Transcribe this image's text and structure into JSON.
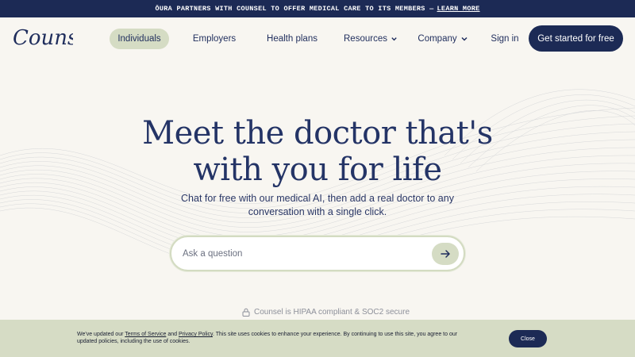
{
  "announcement": {
    "text": "ŌURA PARTNERS WITH COUNSEL TO OFFER MEDICAL CARE TO ITS MEMBERS —",
    "link": "LEARN MORE"
  },
  "nav": {
    "logo_text": "Counsel",
    "items": [
      {
        "label": "Individuals",
        "active": true
      },
      {
        "label": "Employers"
      },
      {
        "label": "Health plans"
      },
      {
        "label": "Resources",
        "has_dropdown": true
      },
      {
        "label": "Company",
        "has_dropdown": true
      },
      {
        "label": "Sign in"
      }
    ],
    "cta": "Get started for free"
  },
  "hero": {
    "title_line1": "Meet the doctor that's",
    "title_line2": "with you for life",
    "subtitle": "Chat for free with our medical AI, then add a real doctor to any conversation with a single click."
  },
  "search": {
    "placeholder": "Ask a question",
    "submit_icon": "arrow-right-icon"
  },
  "security": {
    "icon": "lock-icon",
    "text": "Counsel is HIPAA compliant & SOC2 secure"
  },
  "cookie": {
    "prefix": "We've updated our",
    "terms": "Terms of Service",
    "and": "and",
    "privacy": "Privacy Policy",
    "suffix": ". This site uses cookies to enhance your experience. By continuing to use this site, you agree to our updated policies, including the use of cookies.",
    "close": "Close"
  },
  "colors": {
    "navy": "#1c2a55",
    "sage": "#d5dcc4",
    "background": "#f8f6f1"
  }
}
